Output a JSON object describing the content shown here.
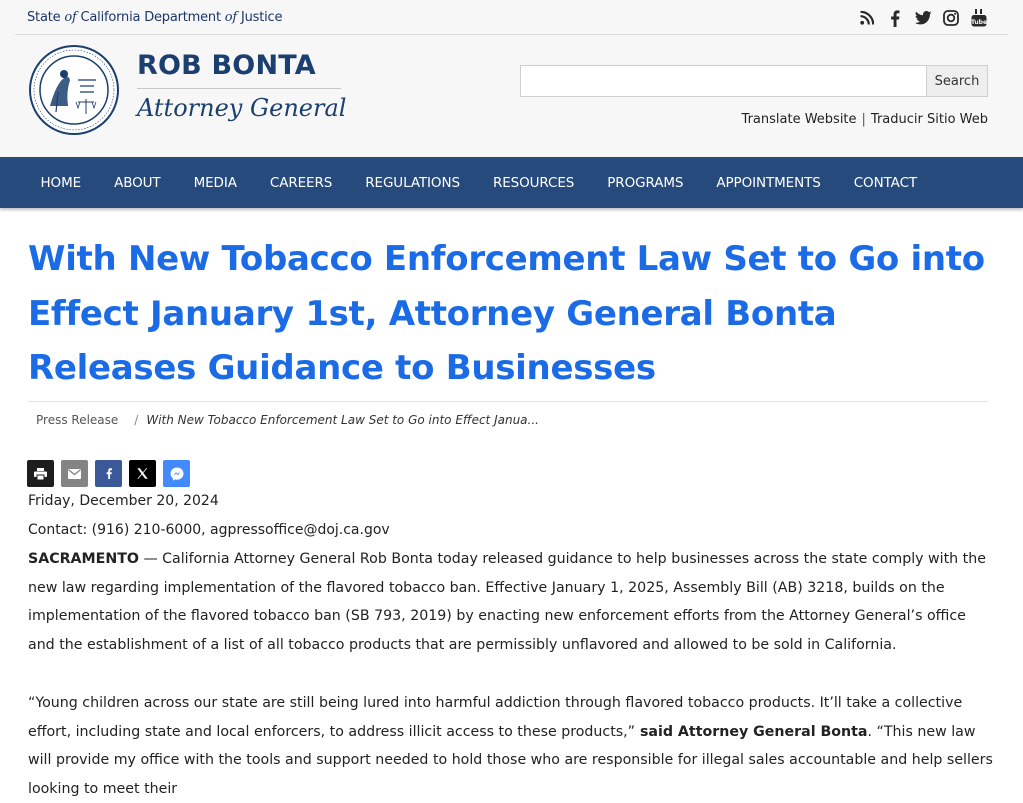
{
  "topbar": {
    "dept_part1": "State ",
    "dept_of1": "of",
    "dept_part2": " California Department ",
    "dept_of2": "of",
    "dept_part3": " Justice",
    "social_icons": [
      "rss-icon",
      "facebook-icon",
      "twitter-icon",
      "instagram-icon",
      "youtube-icon"
    ]
  },
  "header": {
    "name": "ROB BONTA",
    "title": "Attorney General",
    "search_placeholder": "",
    "search_button": "Search",
    "translate_en": "Translate Website",
    "translate_sep": "|",
    "translate_es": "Traducir Sitio Web"
  },
  "nav": {
    "items": [
      "HOME",
      "ABOUT",
      "MEDIA",
      "CAREERS",
      "REGULATIONS",
      "RESOURCES",
      "PROGRAMS",
      "APPOINTMENTS",
      "CONTACT"
    ]
  },
  "article": {
    "headline": "With New Tobacco Enforcement Law Set to Go into Effect January 1st, Attorney General Bonta Releases Guidance to Businesses",
    "breadcrumb_root": "Press Release",
    "breadcrumb_sep": "/",
    "breadcrumb_current": "With New Tobacco Enforcement Law Set to Go into Effect Janua...",
    "date": "Friday, December 20, 2024",
    "contact": "Contact: (916) 210-6000, agpressoffice@doj.ca.gov",
    "p1_lead": "SACRAMENTO",
    "p1_text": " — California Attorney General Rob Bonta today released guidance to help businesses across the state comply with the new law regarding implementation of the flavored tobacco ban. Effective January 1, 2025, Assembly Bill (AB) 3218, builds on the implementation of the flavored tobacco ban (SB 793, 2019) by enacting new enforcement efforts from the Attorney General’s office and the establishment of a list of all tobacco products that are permissibly unflavored and allowed to be sold in California.",
    "p2_a": "“Young children across our state are still being lured into harmful addiction through flavored tobacco products. It’ll take a collective effort, including state and local enforcers, to address illicit access to these products,”",
    "p2_bold": " said Attorney General Bonta",
    "p2_b": ". “This new law will provide my office with the tools and support needed to hold those who are responsible for illegal sales accountable and help sellers looking to meet their"
  },
  "share": {
    "icons": [
      "print-icon",
      "email-icon",
      "facebook-share-icon",
      "x-share-icon",
      "messenger-share-icon"
    ],
    "colors": [
      "#1e1e1e",
      "#848484",
      "#3b5998",
      "#000000",
      "#448aff"
    ]
  },
  "colors": {
    "navy": "#264a7b",
    "brand": "#1b3f6e",
    "headline": "#1a6be5"
  }
}
